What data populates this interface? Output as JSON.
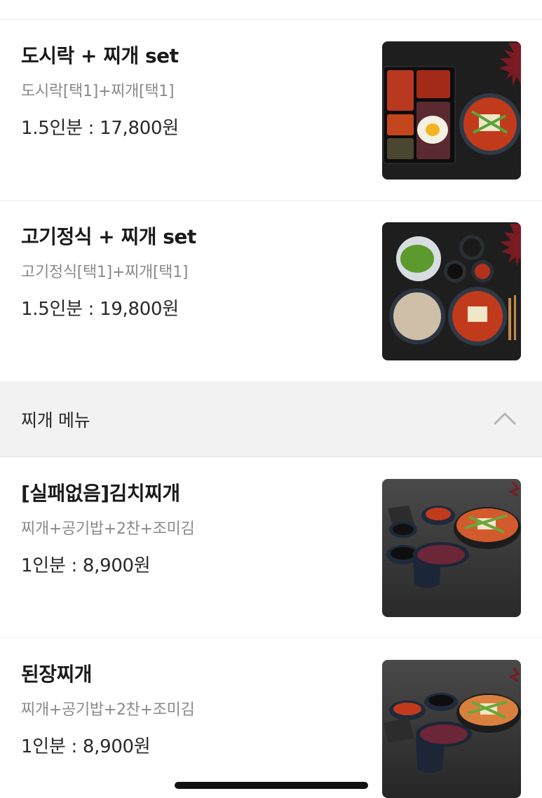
{
  "menu_top": [
    {
      "name": "도시락 + 찌개 set",
      "desc": "도시락[택1]+찌개[택1]",
      "price": "1.5인분 : 17,800원",
      "image_icon": "dosirak-set-photo-icon"
    },
    {
      "name": "고기정식 + 찌개 set",
      "desc": "고기정식[택1]+찌개[택1]",
      "price": "1.5인분 : 19,800원",
      "image_icon": "meat-set-photo-icon"
    }
  ],
  "section": {
    "title": "찌개 메뉴",
    "toggle_icon": "chevron-up-icon"
  },
  "menu_stew": [
    {
      "name": "[실패없음]김치찌개",
      "desc": "찌개+공기밥+2찬+조미김",
      "price": "1인분 : 8,900원",
      "image_icon": "kimchi-stew-photo-icon"
    },
    {
      "name": "된장찌개",
      "desc": "찌개+공기밥+2찬+조미김",
      "price": "1인분 : 8,900원",
      "image_icon": "doenjang-stew-photo-icon"
    }
  ],
  "colors": {
    "divider": "#ececec",
    "section_bg": "#f2f2f2",
    "desc_text": "#8a8a8a",
    "photo_bg_dark": "#1f1f1f"
  }
}
